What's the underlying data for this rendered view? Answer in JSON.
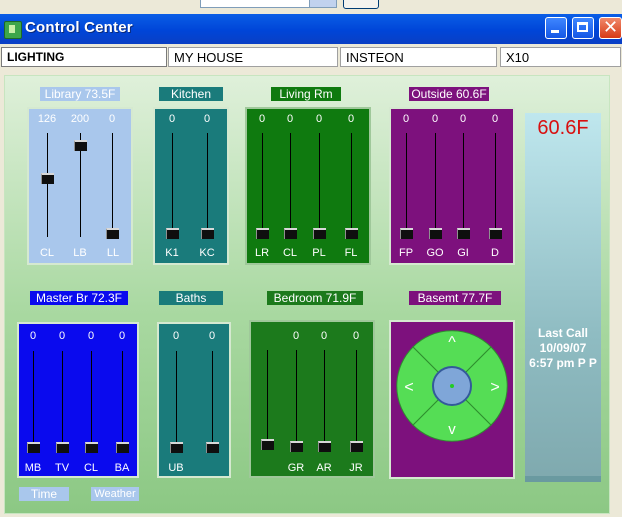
{
  "window": {
    "title": "Control Center"
  },
  "tabs": [
    "LIGHTING",
    "MY HOUSE",
    "INSTEON",
    "X10"
  ],
  "groups": [
    {
      "title": "Library 73.5F",
      "values": [
        "126",
        "200",
        "0"
      ],
      "labels": [
        "CL",
        "LB",
        "LL"
      ],
      "levels": [
        0.49,
        0.78,
        0.0
      ]
    },
    {
      "title": "Kitchen",
      "values": [
        "0",
        "0"
      ],
      "labels": [
        "K1",
        "KC"
      ],
      "levels": [
        0,
        0
      ]
    },
    {
      "title": "Living Rm",
      "values": [
        "0",
        "0",
        "0",
        "0"
      ],
      "labels": [
        "LR",
        "CL",
        "PL",
        "FL"
      ],
      "levels": [
        0,
        0,
        0,
        0
      ]
    },
    {
      "title": "Outside 60.6F",
      "values": [
        "0",
        "0",
        "0",
        "0"
      ],
      "labels": [
        "FP",
        "GO",
        "GI",
        "D"
      ],
      "levels": [
        0,
        0,
        0,
        0
      ]
    },
    {
      "title": "Master Br 72.3F",
      "values": [
        "0",
        "0",
        "0",
        "0"
      ],
      "labels": [
        "MB",
        "TV",
        "CL",
        "BA"
      ],
      "levels": [
        0,
        0,
        0,
        0
      ]
    },
    {
      "title": "Baths",
      "values": [
        "0",
        "0"
      ],
      "labels": [
        "UB",
        ""
      ],
      "levels": [
        0,
        0
      ]
    },
    {
      "title": "Bedroom 71.9F",
      "values": [
        "",
        "0",
        "0",
        "0"
      ],
      "labels": [
        "",
        "GR",
        "AR",
        "JR"
      ],
      "levels": [
        0,
        0,
        0,
        0
      ]
    }
  ],
  "basement": {
    "title": "Basemt 77.7F",
    "up": "^",
    "down": "v",
    "left": "<",
    "right": ">"
  },
  "weather": {
    "temp": "60.6F",
    "last_call": "Last Call",
    "date": "10/09/07",
    "time": "6:57 pm P P"
  },
  "bottom_tabs": [
    "Time",
    "Weather"
  ],
  "colors": {
    "library": "#a9c7ec",
    "kitchen": "#1a7b7b",
    "living": "#0f7a0f",
    "outside": "#7d117d",
    "master": "#0a0aee",
    "baths": "#1a7b7b",
    "bedroom": "#1c7a1c",
    "basement": "#7d117d",
    "dpad": "#55dd55"
  }
}
